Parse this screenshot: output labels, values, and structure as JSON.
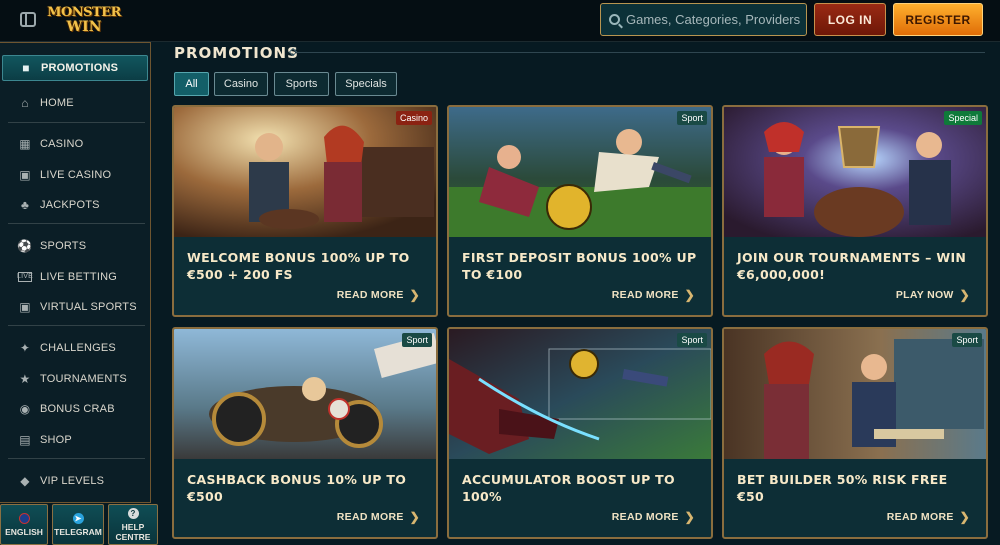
{
  "header": {
    "logo_line1": "MONSTER",
    "logo_line2": "WIN",
    "search_placeholder": "Games, Categories, Providers",
    "login_label": "LOG IN",
    "register_label": "REGISTER"
  },
  "sidebar": {
    "items": [
      {
        "label": "PROMOTIONS",
        "icon": "promo-icon"
      },
      {
        "label": "HOME",
        "icon": "home-icon"
      },
      {
        "label": "CASINO",
        "icon": "slot-icon"
      },
      {
        "label": "LIVE CASINO",
        "icon": "cards-icon"
      },
      {
        "label": "JACKPOTS",
        "icon": "clover-icon"
      },
      {
        "label": "SPORTS",
        "icon": "ball-icon"
      },
      {
        "label": "LIVE BETTING",
        "icon": "live-icon"
      },
      {
        "label": "VIRTUAL SPORTS",
        "icon": "monitor-icon"
      },
      {
        "label": "CHALLENGES",
        "icon": "medal-icon"
      },
      {
        "label": "TOURNAMENTS",
        "icon": "trophy-icon"
      },
      {
        "label": "BONUS CRAB",
        "icon": "crab-icon"
      },
      {
        "label": "SHOP",
        "icon": "bag-icon"
      },
      {
        "label": "VIP LEVELS",
        "icon": "diamond-icon"
      }
    ],
    "bottom": [
      {
        "label": "ENGLISH"
      },
      {
        "label": "TELEGRAM"
      },
      {
        "label1": "HELP",
        "label2": "CENTRE"
      }
    ]
  },
  "main": {
    "title": "PROMOTIONS",
    "filters": [
      "All",
      "Casino",
      "Sports",
      "Specials"
    ],
    "cards": [
      {
        "badge": "Casino",
        "title": "WELCOME BONUS 100% UP TO €500 + 200 FS",
        "cta": "READ MORE"
      },
      {
        "badge": "Sport",
        "title": "FIRST DEPOSIT BONUS 100% UP TO €100",
        "cta": "READ MORE"
      },
      {
        "badge": "Special",
        "title": "JOIN OUR TOURNAMENTS – WIN €6,000,000!",
        "cta": "PLAY NOW"
      },
      {
        "badge": "Sport",
        "title": "CASHBACK BONUS 10% UP TO €500",
        "cta": "READ MORE"
      },
      {
        "badge": "Sport",
        "title": "ACCUMULATOR BOOST UP TO 100%",
        "cta": "READ MORE"
      },
      {
        "badge": "Sport",
        "title": "BET BUILDER 50% RISK FREE €50",
        "cta": "READ MORE"
      }
    ]
  },
  "colors": {
    "accent_gold": "#b89550",
    "teal_active": "#135f68",
    "register_orange": "#ff9a1f",
    "login_red": "#8a2410"
  }
}
